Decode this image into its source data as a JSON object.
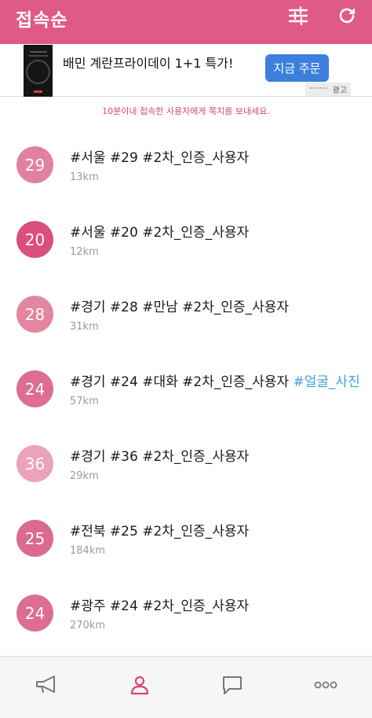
{
  "appbar": {
    "title": "접속순",
    "color": "#e05a86"
  },
  "ad": {
    "headline": "배민 계란프라이데이 1+1 특가!",
    "cta": "지금 주문",
    "badge": "광고"
  },
  "notice": "10분이내 접속한 사용자에게 쪽지를 보내세요.",
  "users": [
    {
      "age": "29",
      "tags": "#서울 #29 #2차_인증_사용자",
      "extra": "",
      "distance": "13km",
      "color": "#e2809f"
    },
    {
      "age": "20",
      "tags": "#서울 #20 #2차_인증_사용자",
      "extra": "",
      "distance": "12km",
      "color": "#db4f7c"
    },
    {
      "age": "28",
      "tags": "#경기 #28 #만남 #2차_인증_사용자",
      "extra": "",
      "distance": "31km",
      "color": "#e4869f"
    },
    {
      "age": "24",
      "tags": "#경기 #24 #대화 #2차_인증_사용자",
      "extra": "#얼굴_사진",
      "distance": "57km",
      "color": "#dd6e91"
    },
    {
      "age": "36",
      "tags": "#경기 #36 #2차_인증_사용자",
      "extra": "",
      "distance": "29km",
      "color": "#eca2b8"
    },
    {
      "age": "25",
      "tags": "#전북 #25 #2차_인증_사용자",
      "extra": "",
      "distance": "184km",
      "color": "#db6a8e"
    },
    {
      "age": "24",
      "tags": "#광주 #24 #2차_인증_사용자",
      "extra": "",
      "distance": "270km",
      "color": "#dd6e91"
    }
  ],
  "bottomnav": {
    "items": [
      "megaphone-icon",
      "person-icon",
      "chat-icon",
      "more-icon"
    ],
    "active": "person-icon",
    "active_color": "#d7457a",
    "inactive_color": "#777777"
  }
}
